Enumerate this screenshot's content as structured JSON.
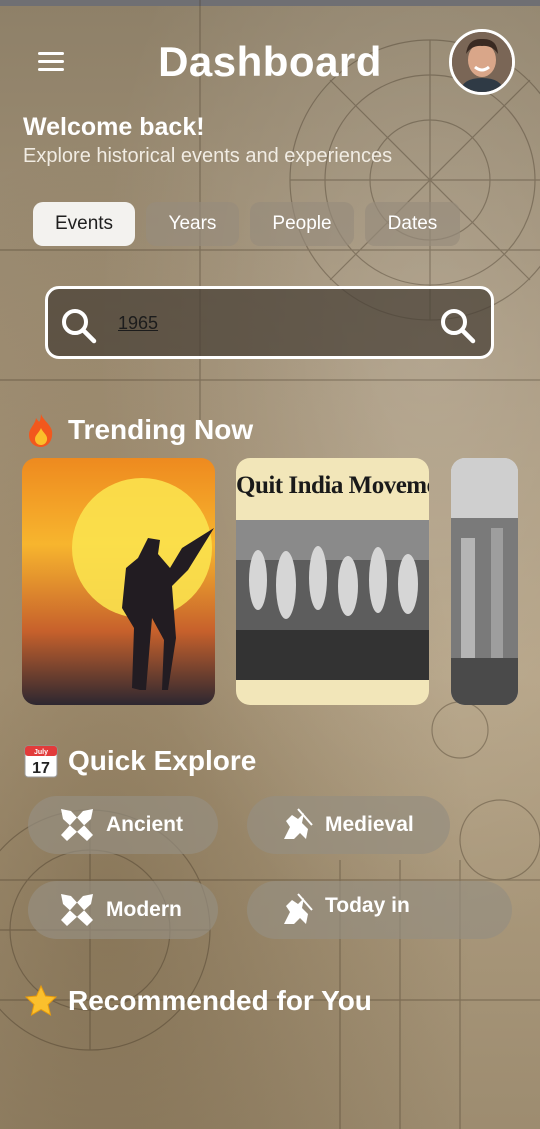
{
  "header": {
    "title": "Dashboard"
  },
  "welcome": {
    "heading": "Welcome back!",
    "subtitle": "Explore historical events and experiences"
  },
  "filters": [
    {
      "label": "Events",
      "active": true
    },
    {
      "label": "Years",
      "active": false
    },
    {
      "label": "People",
      "active": false
    },
    {
      "label": "Dates",
      "active": false
    }
  ],
  "search": {
    "value": "1965"
  },
  "trending": {
    "title": "Trending Now",
    "cards": [
      {
        "caption": ""
      },
      {
        "caption": "Quit India Movement"
      },
      {
        "caption": ""
      }
    ]
  },
  "quick_explore": {
    "title": "Quick Explore",
    "calendar_month": "July",
    "calendar_day": "17",
    "items": [
      {
        "label": "Ancient",
        "icon": "swords-icon"
      },
      {
        "label": "Medieval",
        "icon": "knight-icon"
      },
      {
        "label": "Modern",
        "icon": "swords-icon"
      },
      {
        "label": "Today in",
        "icon": "knight-icon"
      }
    ]
  },
  "recommended": {
    "title": "Recommended for You"
  },
  "colors": {
    "active_chip": "#f3f2ef",
    "chip": "#968c7d",
    "accent_orange": "#f08a1f"
  }
}
